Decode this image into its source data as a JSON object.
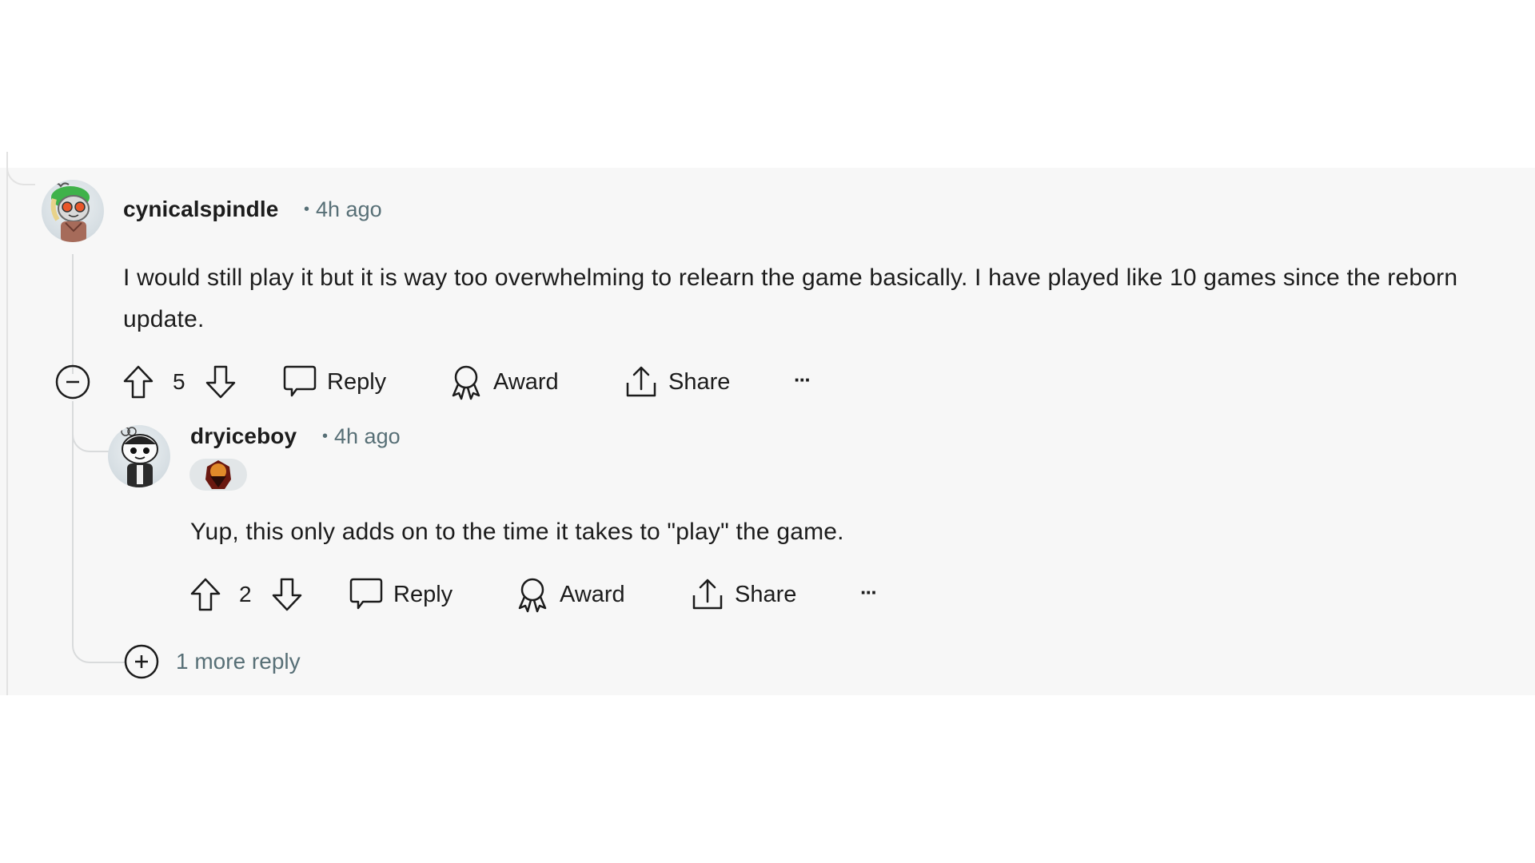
{
  "comments": [
    {
      "username": "cynicalspindle",
      "time": "4h ago",
      "body": "I would still play it but it is way too overwhelming to relearn the game basically. I have played like 10 games since the reborn update.",
      "score": "5",
      "actions": {
        "reply": "Reply",
        "award": "Award",
        "share": "Share",
        "more": "···"
      },
      "collapsed": false
    },
    {
      "username": "dryiceboy",
      "time": "4h ago",
      "has_flair_badge": true,
      "body": "Yup, this only adds on to the time it takes to \"play\" the game.",
      "score": "2",
      "actions": {
        "reply": "Reply",
        "award": "Award",
        "share": "Share",
        "more": "···"
      }
    }
  ],
  "more_replies": {
    "label": "1 more reply"
  },
  "separator": "•",
  "colors": {
    "panel_bg": "#f7f7f7",
    "meta_text": "#576f76",
    "thread_line": "#d9dbdc",
    "text": "#1c1c1c"
  }
}
